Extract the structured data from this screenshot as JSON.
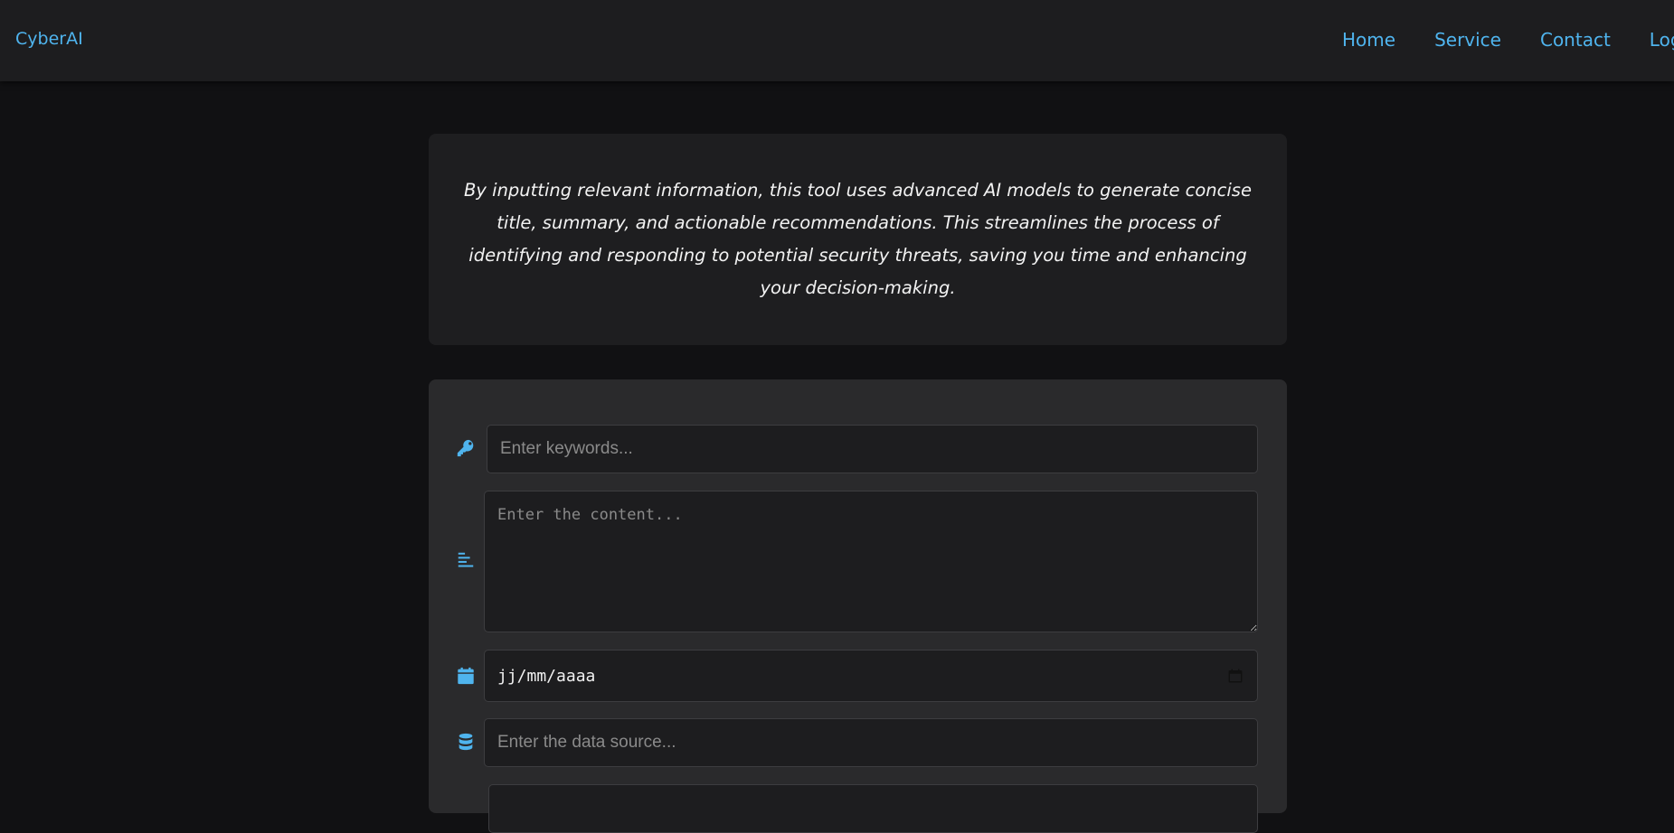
{
  "navbar": {
    "brand": "CyberAI",
    "links": [
      "Home",
      "Service",
      "Contact",
      "Log"
    ]
  },
  "intro": {
    "text": "By inputting relevant information, this tool uses advanced AI models to generate concise title, summary, and actionable recommendations. This streamlines the process of identifying and responding to potential security threats, saving you time and enhancing your decision-making."
  },
  "form": {
    "keywords_placeholder": "Enter keywords...",
    "content_placeholder": "Enter the content...",
    "date_value": "jj/mm/aaaa",
    "source_placeholder": "Enter the data source..."
  },
  "icons": {
    "keywords": "key-icon",
    "content": "align-left-icon",
    "date": "calendar-icon",
    "source": "database-icon",
    "date_picker": "calendar-picker-icon"
  },
  "colors": {
    "accent": "#4fb4ee",
    "background": "#111113",
    "navbar": "#1d1d1f",
    "card": "#1e1e20",
    "form_card": "#2a2a2c"
  }
}
